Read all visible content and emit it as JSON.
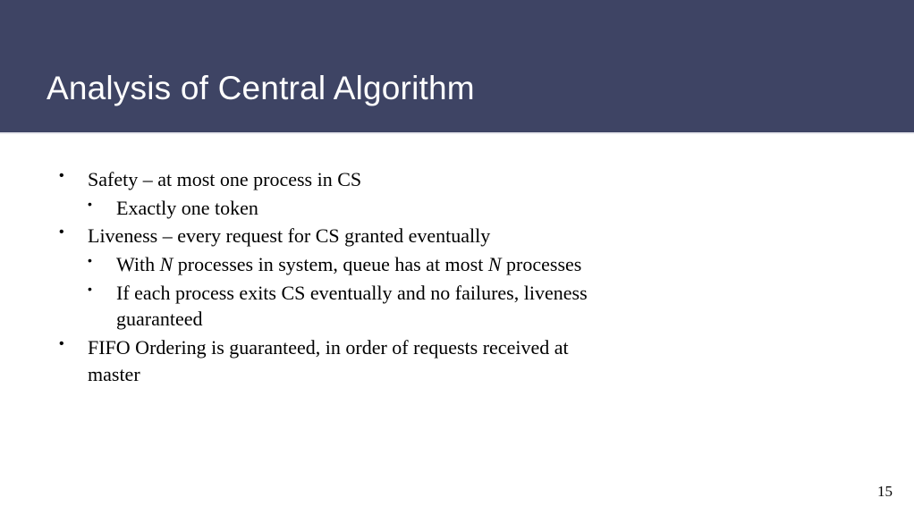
{
  "title": "Analysis of Central Algorithm",
  "bullets": {
    "b1": "Safety – at most one process in CS",
    "b1a": "Exactly one token",
    "b2": "Liveness – every request for CS granted eventually",
    "b2a_pre": "With ",
    "b2a_N1": "N",
    "b2a_mid": " processes in system, queue has at most ",
    "b2a_N2": "N",
    "b2a_post": " processes",
    "b2b": "If each process exits CS eventually and no failures, liveness guaranteed",
    "b3": "FIFO Ordering is guaranteed, in order of requests received at master"
  },
  "page_number": "15"
}
